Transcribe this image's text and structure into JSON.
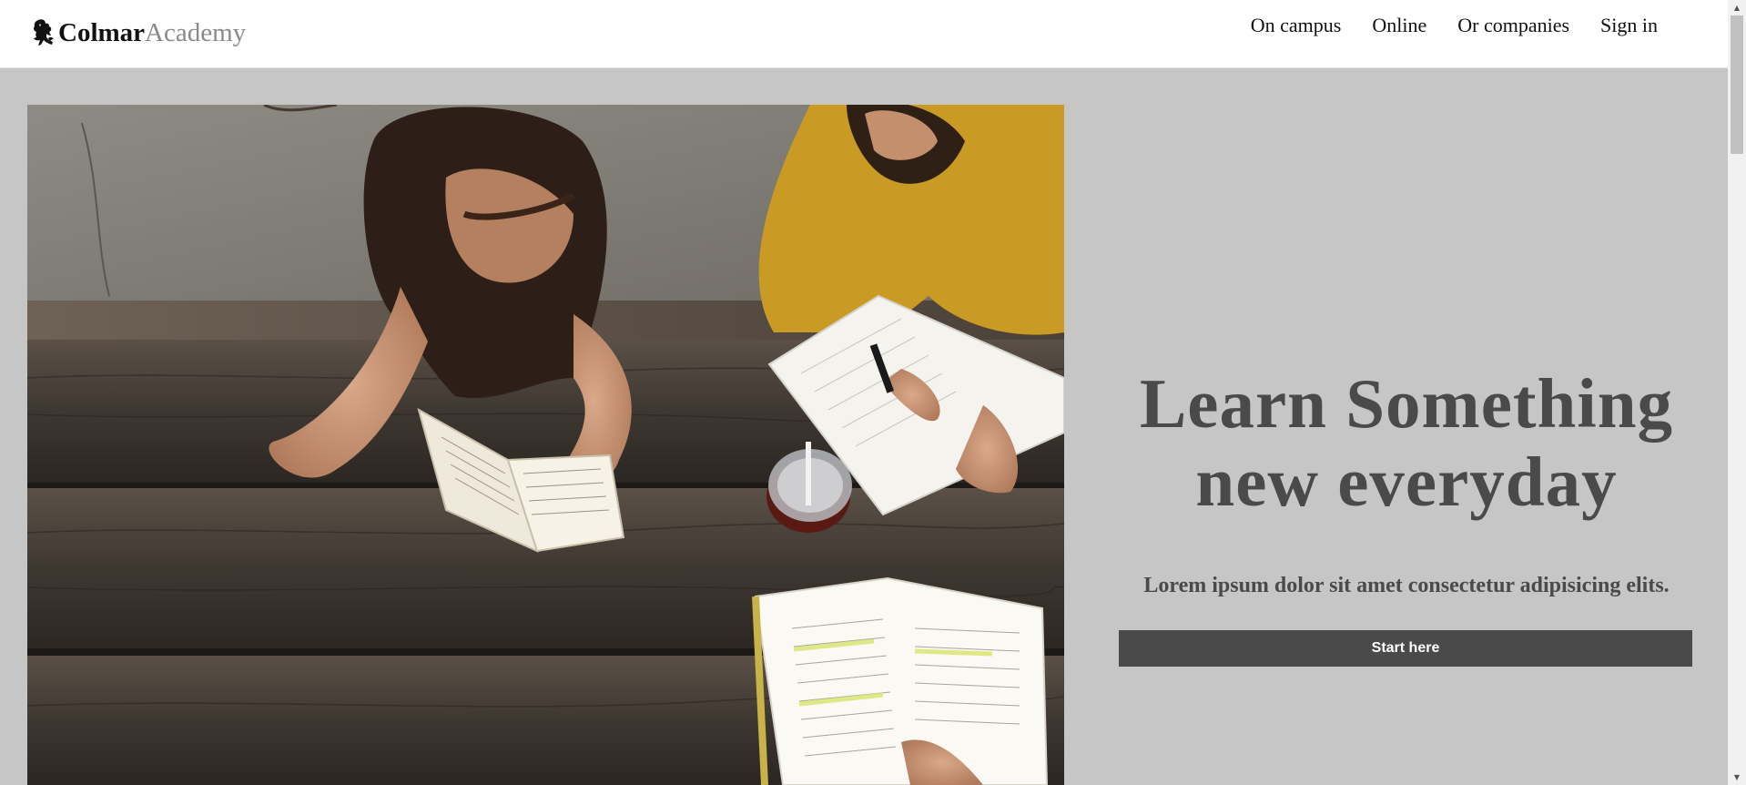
{
  "header": {
    "logo": {
      "strong": "Colmar",
      "light": "Academy",
      "icon": "rearing-lion-icon"
    },
    "nav": [
      {
        "label": "On campus"
      },
      {
        "label": "Online"
      },
      {
        "label": "Or companies"
      },
      {
        "label": "Sign in"
      }
    ]
  },
  "hero": {
    "image": "students-studying-at-wooden-table",
    "headline_line1": "Learn Something",
    "headline_line2": "new everyday",
    "subline": "Lorem ipsum dolor sit amet consectetur adipisicing elits.",
    "cta_label": "Start here"
  },
  "colors": {
    "page_bg": "#c6c6c6",
    "header_bg": "#ffffff",
    "text_dark": "#4a4a4a",
    "button_bg": "#4a4a4a",
    "button_text": "#ffffff"
  }
}
